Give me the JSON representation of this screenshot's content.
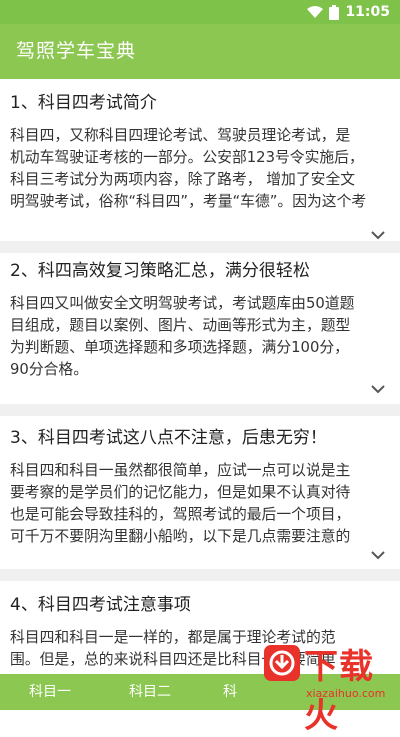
{
  "status_bar": {
    "time": "11:05",
    "wifi_icon": "wifi-icon",
    "battery_icon": "battery-icon"
  },
  "app_bar": {
    "title": "驾照学车宝典"
  },
  "articles": [
    {
      "title": "1、科目四考试简介",
      "body": "科目四，又称科目四理论考试、驾驶员理论考试，是\n机动车驾驶证考核的一部分。公安部123号令实施后，\n科目三考试分为两项内容，除了路考， 增加了安全文\n明驾驶考试，俗称“科目四”，考量“车德”。因为这个考"
    },
    {
      "title": "2、科四高效复习策略汇总，满分很轻松",
      "body": "科目四又叫做安全文明驾驶考试，考试题库由50道题\n目组成，题目以案例、图片、动画等形式为主，题型\n为判断题、单项选择题和多项选择题，满分100分，\n90分合格。"
    },
    {
      "title": "3、科目四考试这八点不注意，后患无穷！",
      "body": "科目四和科目一虽然都很简单，应试一点可以说是主\n要考察的是学员们的记忆能力，但是如果不认真对待\n也是可能会导致挂科的，驾照考试的最后一个项目，\n可千万不要阴沟里翻小船哟，以下是几点需要注意的"
    },
    {
      "title": "4、科目四考试注意事项",
      "body": "科目四和科目一是一样的，都是属于理论考试的范\n围。但是，总的来说科目四还是比科目一还要简单"
    }
  ],
  "bottom_nav": {
    "items": [
      "科目一",
      "科目二",
      "科"
    ]
  },
  "watermark": {
    "text": "下载火",
    "url": "xiazaihuo.com"
  },
  "colors": {
    "primary": "#8cc751",
    "status": "#7fc24a",
    "watermark": "#e8322a"
  }
}
